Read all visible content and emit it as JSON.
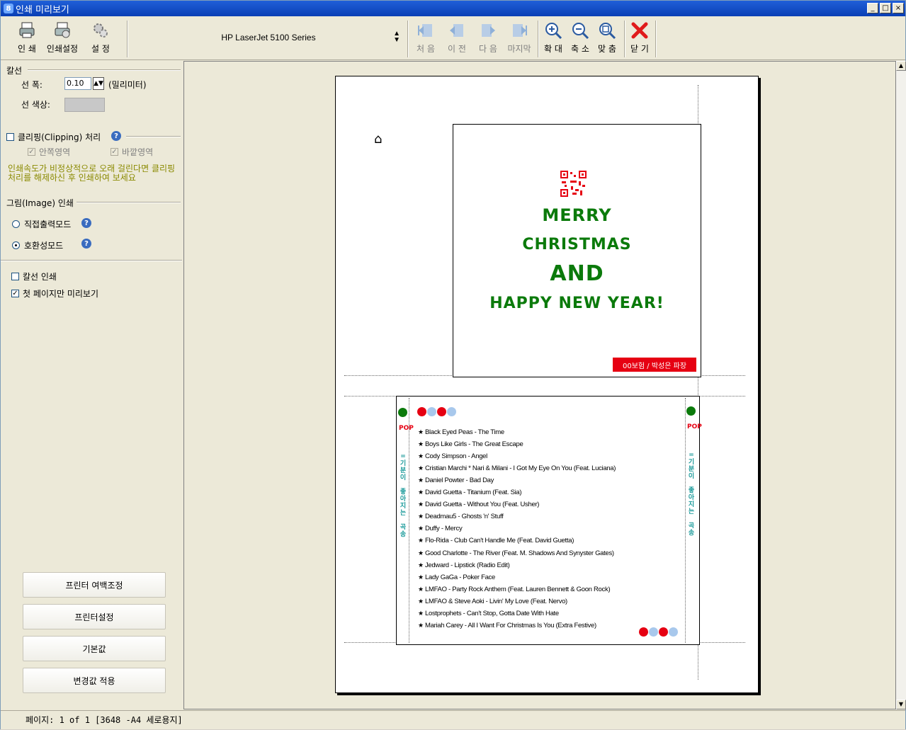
{
  "window": {
    "title": "인쇄 미리보기",
    "app_icon": "8"
  },
  "toolbar": {
    "print": "인 쇄",
    "print_settings": "인쇄설정",
    "settings": "설 정",
    "printer_name": "HP LaserJet 5100 Series",
    "first": "처 음",
    "prev": "이 전",
    "next": "다 음",
    "last": "마지막",
    "zoom_in": "확 대",
    "zoom_out": "축 소",
    "fit": "맞 춤",
    "close": "닫 기"
  },
  "panel": {
    "cutline_label": "칼선",
    "line_width_label": "선 폭:",
    "line_width_value": "0.10",
    "line_width_unit": "(밀리미터)",
    "line_color_label": "선 색상:",
    "clipping_label": "클리핑(Clipping) 처리",
    "clip_inner": "안쪽영역",
    "clip_outer": "바깥영역",
    "warning": "인쇄속도가 비정상적으로 오래 걸린다면 클리핑처리를 해제하신 후 인쇄하여 보세요",
    "image_print_label": "그림(Image) 인쇄",
    "direct_mode": "직접출력모드",
    "compat_mode": "호환성모드",
    "print_cutline": "칼선 인쇄",
    "first_page_only": "첫 페이지만 미리보기",
    "btn_margin": "프린터 여백조정",
    "btn_printer_settings": "프린터설정",
    "btn_defaults": "기본값",
    "btn_apply": "변경값 적용"
  },
  "status": {
    "text": "페이지:  1 of 1  [3648 -A4 세로용지]"
  },
  "card_front": {
    "line1": "MERRY",
    "line2": "CHRISTMAS",
    "line3": "AND",
    "line4": "HAPPY NEW YEAR!",
    "tag": "00보험 / 박성은 파장"
  },
  "card_back": {
    "side_pop": "POP",
    "side_text_1": "=기분이",
    "side_text_2": "좋아지는",
    "side_text_3": "곡송",
    "songs": [
      "Black Eyed Peas - The Time",
      "Boys Like Girls - The Great Escape",
      "Cody Simpson - Angel",
      "Cristian Marchi * Nari & Milani - I Got My Eye On You (Feat. Luciana)",
      "Daniel Powter - Bad Day",
      "David Guetta - Titanium (Feat. Sia)",
      "David Guetta - Without You (Feat. Usher)",
      "Deadmau5 - Ghosts 'n' Stuff",
      "Duffy - Mercy",
      "Flo-Rida - Club Can't Handle Me (Feat. David Guetta)",
      "Good Charlotte - The River (Feat. M. Shadows And Synyster Gates)",
      "Jedward - Lipstick (Radio Edit)",
      "Lady GaGa - Poker Face",
      "LMFAO - Party Rock Anthem (Feat. Lauren Bennett & Goon Rock)",
      "LMFAO & Steve Aoki - Livin' My Love (Feat. Nervo)",
      "Lostprophets - Can't Stop, Gotta Date With Hate",
      "Mariah Carey - All I Want For Christmas Is You (Extra Festive)"
    ]
  },
  "colors": {
    "accent_green": "#0b7a0b",
    "accent_red": "#e60012",
    "dot_blue": "#a8c8ec"
  }
}
